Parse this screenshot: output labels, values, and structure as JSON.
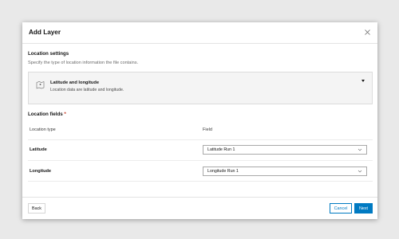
{
  "dialog": {
    "title": "Add Layer",
    "close_icon": "close-icon"
  },
  "location_settings": {
    "title": "Location settings",
    "description": "Specify the type of location information the file contains.",
    "selected_type": {
      "icon": "map-pin-icon",
      "label": "Latitude and longitude",
      "description": "Location data are latitude and longitude."
    }
  },
  "location_fields": {
    "title": "Location fields",
    "required_marker": "*",
    "column_headers": [
      "Location type",
      "Field"
    ],
    "rows": [
      {
        "type": "Latitude",
        "field": "Latitude Run 1"
      },
      {
        "type": "Longitude",
        "field": "Longitude Run 1"
      }
    ]
  },
  "footer": {
    "back_label": "Back",
    "cancel_label": "Cancel",
    "next_label": "Next"
  },
  "colors": {
    "accent": "#007ac2",
    "required": "#c4351e",
    "backdrop": "#e9e9e9"
  }
}
